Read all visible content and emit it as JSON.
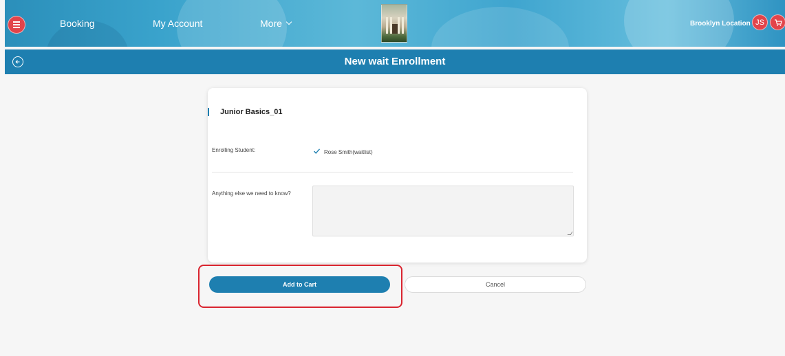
{
  "header": {
    "nav": {
      "booking": "Booking",
      "account": "My Account",
      "more": "More"
    },
    "location": "Brooklyn Location",
    "avatar_initials": "JS"
  },
  "titlebar": {
    "title": "New wait Enrollment"
  },
  "form": {
    "course_name": "Junior Basics_01",
    "student_label": "Enrolling Student:",
    "student_name": "Rose Smith(waitlist)",
    "notes_label": "Anything else we need to know?",
    "notes_value": ""
  },
  "actions": {
    "add_to_cart": "Add to Cart",
    "cancel": "Cancel"
  },
  "colors": {
    "primary": "#1e7fb0",
    "accent_red": "#e2444a",
    "highlight": "#d9242f"
  },
  "icons": {
    "menu": "hamburger-icon",
    "back": "arrow-left-icon",
    "cart": "cart-icon",
    "check": "check-icon",
    "chevron": "chevron-down-icon"
  }
}
